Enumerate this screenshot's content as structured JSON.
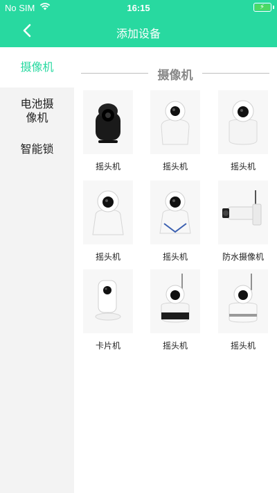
{
  "status_bar": {
    "carrier": "No SIM",
    "time": "16:15"
  },
  "nav": {
    "title": "添加设备"
  },
  "sidebar": {
    "items": [
      {
        "label": "摄像机"
      },
      {
        "label": "电池摄\n像机"
      },
      {
        "label": "智能锁"
      }
    ]
  },
  "section": {
    "title": "摄像机",
    "products": [
      {
        "label": "摇头机",
        "icon": "black-camera-icon"
      },
      {
        "label": "摇头机",
        "icon": "white-camera-icon"
      },
      {
        "label": "摇头机",
        "icon": "white-camera-icon"
      },
      {
        "label": "摇头机",
        "icon": "white-camera-icon"
      },
      {
        "label": "摇头机",
        "icon": "white-camera-icon"
      },
      {
        "label": "防水摄像机",
        "icon": "bullet-camera-icon"
      },
      {
        "label": "卡片机",
        "icon": "card-camera-icon"
      },
      {
        "label": "摇头机",
        "icon": "antenna-camera-icon"
      },
      {
        "label": "摇头机",
        "icon": "antenna-camera-icon"
      }
    ]
  },
  "colors": {
    "accent": "#28d9a0",
    "sidebar_bg": "#f3f3f3"
  }
}
